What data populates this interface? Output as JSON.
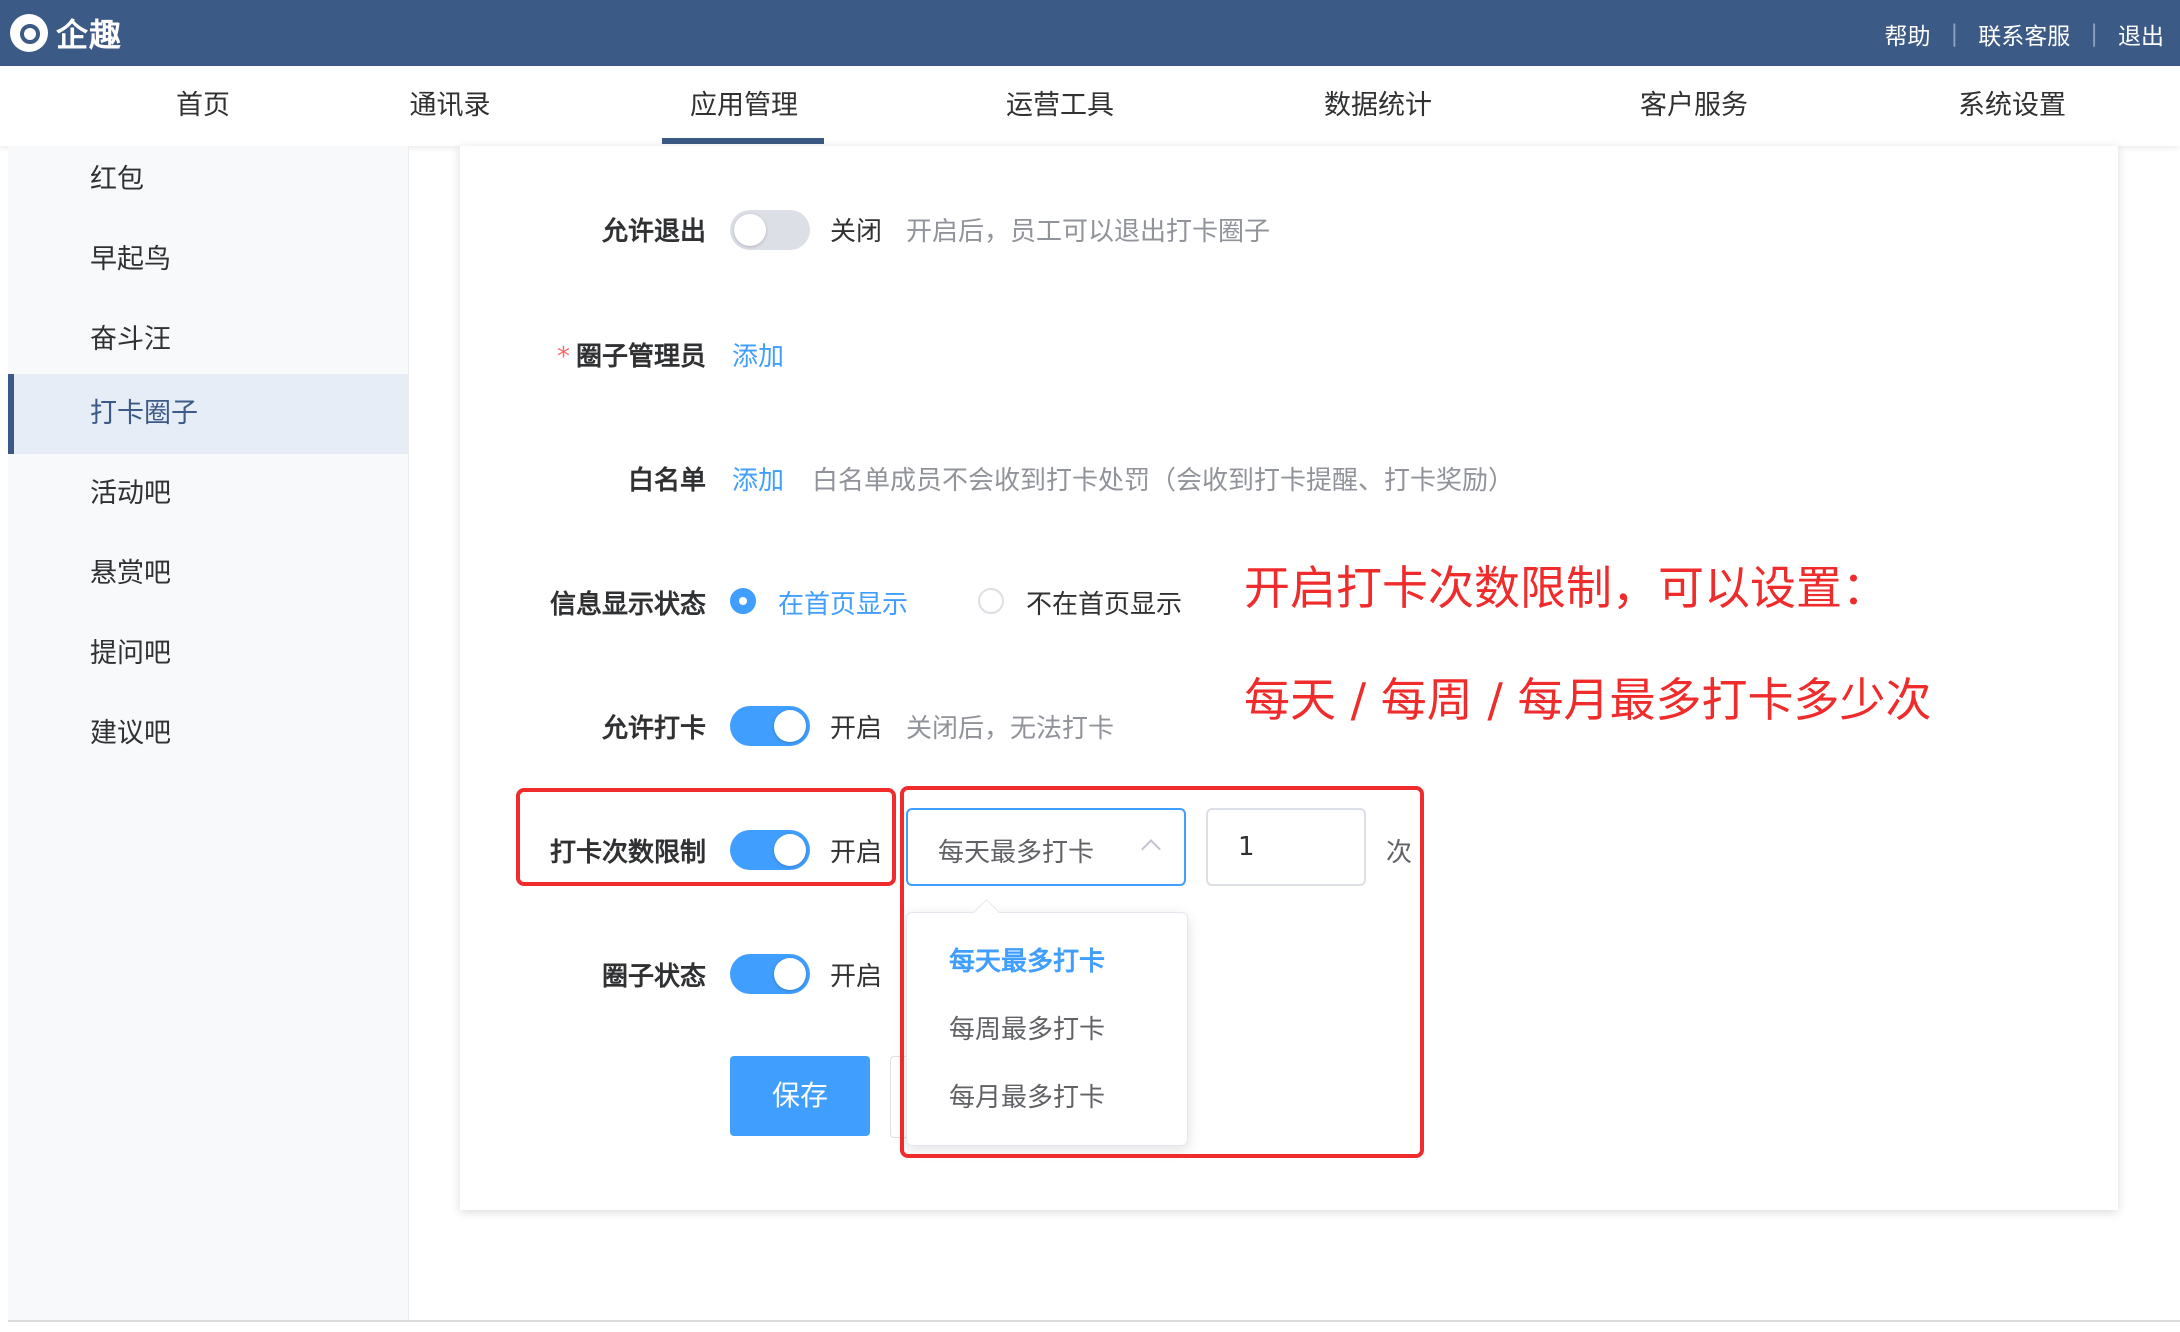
{
  "header": {
    "logo_text": "企趣",
    "links": [
      "帮助",
      "联系客服",
      "退出"
    ]
  },
  "nav": {
    "items": [
      "首页",
      "通讯录",
      "应用管理",
      "运营工具",
      "数据统计",
      "客户服务",
      "系统设置"
    ],
    "active": "应用管理"
  },
  "sidebar": {
    "items": [
      "红包",
      "早起鸟",
      "奋斗汪",
      "打卡圈子",
      "活动吧",
      "悬赏吧",
      "提问吧",
      "建议吧"
    ],
    "active": "打卡圈子"
  },
  "form": {
    "allow_exit": {
      "label": "允许退出",
      "state": "关闭",
      "hint": "开启后，员工可以退出打卡圈子"
    },
    "admin": {
      "required_mark": "*",
      "label": "圈子管理员",
      "action": "添加"
    },
    "whitelist": {
      "label": "白名单",
      "action": "添加",
      "hint": "白名单成员不会收到打卡处罚（会收到打卡提醒、打卡奖励）"
    },
    "display": {
      "label": "信息显示状态",
      "option_on": "在首页显示",
      "option_off": "不在首页显示"
    },
    "allow_checkin": {
      "label": "允许打卡",
      "state": "开启",
      "hint": "关闭后，无法打卡"
    },
    "limit": {
      "label": "打卡次数限制",
      "state": "开启",
      "select_value": "每天最多打卡",
      "count": "1",
      "unit": "次",
      "options": [
        "每天最多打卡",
        "每周最多打卡",
        "每月最多打卡"
      ]
    },
    "circle_status": {
      "label": "圈子状态",
      "state": "开启"
    },
    "save_label": "保存"
  },
  "annotation": {
    "line1": "开启打卡次数限制，可以设置：",
    "line2": "每天 / 每周 / 每月最多打卡多少次"
  },
  "colors": {
    "header": "#3c5a86",
    "primary": "#409eff",
    "annotation": "#ef2b2b"
  }
}
